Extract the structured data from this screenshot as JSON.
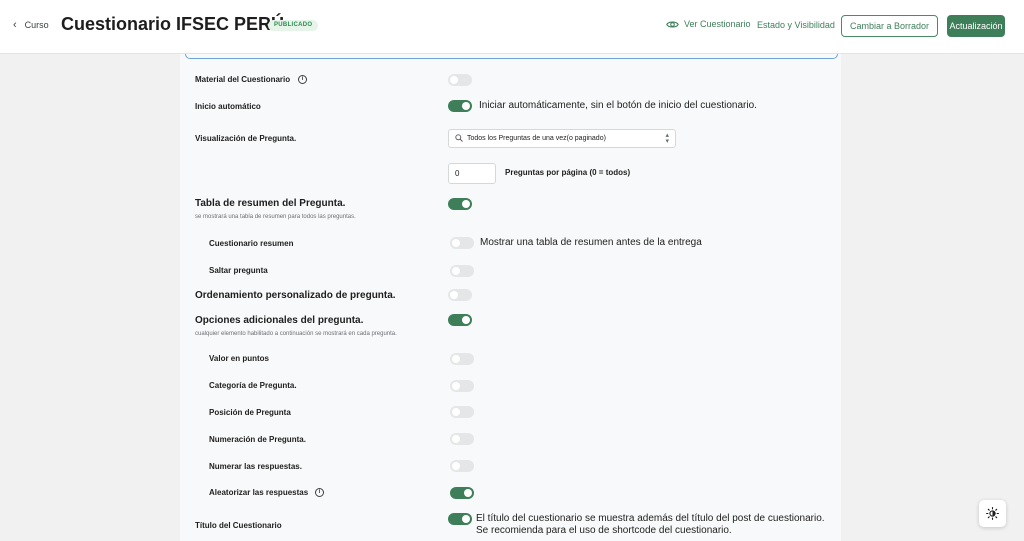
{
  "header": {
    "back_label": "Curso",
    "title": "Cuestionario IFSEC PERÚ",
    "status_badge": "PUBLICADO",
    "view_link": "Ver Cuestionario",
    "status_link": "Estado y Visibilidad",
    "draft_button": "Cambiar a Borrador",
    "update_button": "Actualización",
    "icons": [
      "chevron-left-icon",
      "eye-icon"
    ]
  },
  "settings": {
    "material": {
      "label": "Material del Cuestionario",
      "enabled": false
    },
    "autostart": {
      "label": "Inicio automático",
      "enabled": true,
      "text": "Iniciar automáticamente, sin el botón de inicio del cuestionario."
    },
    "display": {
      "label": "Visualización de Pregunta.",
      "value": "Todos los Preguntas de una vez(o paginado)"
    },
    "per_page": {
      "value": "0",
      "label": "Preguntas por página (0 = todos)"
    },
    "summary_table": {
      "label": "Tabla de resumen del Pregunta.",
      "desc": "se mostrará una tabla de resumen para todos las preguntas.",
      "enabled": true
    },
    "quiz_summary": {
      "label": "Cuestionario resumen",
      "enabled": false,
      "text": "Mostrar una tabla de resumen antes de la entrega"
    },
    "skip_question": {
      "label": "Saltar pregunta",
      "enabled": false
    },
    "custom_order": {
      "label": "Ordenamiento personalizado de pregunta.",
      "enabled": false
    },
    "extra_options": {
      "label": "Opciones adicionales del pregunta.",
      "desc": "cualquier elemento habilitado a continuación se mostrará en cada pregunta.",
      "enabled": true
    },
    "points": {
      "label": "Valor en puntos",
      "enabled": false
    },
    "category": {
      "label": "Categoría de Pregunta.",
      "enabled": false
    },
    "position": {
      "label": "Posición de Pregunta",
      "enabled": false
    },
    "numbering": {
      "label": "Numeración de Pregunta.",
      "enabled": false
    },
    "answer_numbering": {
      "label": "Numerar las respuestas.",
      "enabled": false
    },
    "randomize": {
      "label": "Aleatorizar las respuestas",
      "enabled": true
    },
    "quiz_title": {
      "label": "Título del Cuestionario",
      "enabled": true,
      "text_line1": "El título del cuestionario se muestra además del título del post de cuestionario.",
      "text_line2": "Se recomienda para el uso de shortcode del cuestionario."
    }
  },
  "colors": {
    "accent": "#3e7f5a",
    "toggle_off": "#e4e6e8",
    "badge_bg": "#e6f4ea"
  }
}
